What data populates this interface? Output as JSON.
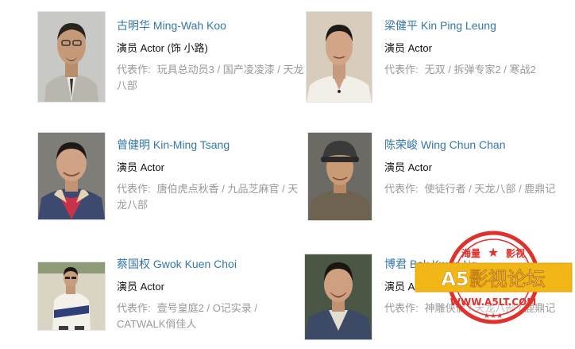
{
  "celebrities": [
    {
      "name": "古明华 Ming-Wah Koo",
      "role": "演员 Actor (饰 小路)",
      "works_label": "代表作:",
      "works": "玩具总动员3 / 国产凌凌漆 / 天龙八部"
    },
    {
      "name": "梁健平 Kin Ping Leung",
      "role": "演员 Actor",
      "works_label": "代表作:",
      "works": "无双 / 拆弹专家2 / 寒战2"
    },
    {
      "name": "曾健明 Kin-Ming Tsang",
      "role": "演员 Actor",
      "works_label": "代表作:",
      "works": "唐伯虎点秋香 / 九品芝麻官 / 天龙八部"
    },
    {
      "name": "陈荣峻 Wing Chun Chan",
      "role": "演员 Actor",
      "works_label": "代表作:",
      "works": "使徒行者 / 天龙八部 / 鹿鼎记"
    },
    {
      "name": "蔡国权 Gwok Kuen Choi",
      "role": "演员 Actor",
      "works_label": "代表作:",
      "works": "壹号皇庭2 / O记实录 / CATWALK俏佳人"
    },
    {
      "name": "博君 Bok Kwan Ng",
      "role": "演员 Actor",
      "works_label": "代表作:",
      "works": "神雕侠侣 / 天龙八部 / 鹿鼎记"
    }
  ],
  "watermark": {
    "top_left": "海量",
    "top_right": "影视",
    "main": "A5影视论坛",
    "url": "WWW.A5LT.COM",
    "color": "#e0322d",
    "banner_color": "#f0b716"
  }
}
